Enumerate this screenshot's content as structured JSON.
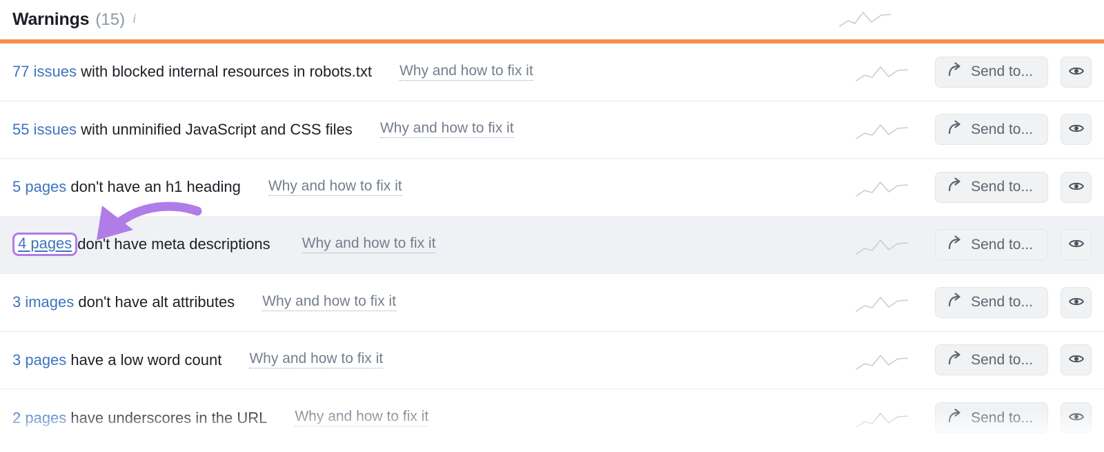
{
  "header": {
    "title": "Warnings",
    "count": "(15)",
    "info_icon": "info-icon",
    "accent_color": "#f8904b"
  },
  "colors": {
    "link_blue": "#3d74bd",
    "annotation_purple": "#b07ce8",
    "highlight_row_bg": "#eff1f5",
    "accent_orange": "#f8904b"
  },
  "actions": {
    "send_to_label": "Send to...",
    "send_to_icon": "share-arrow-icon",
    "preview_icon": "eye-icon",
    "sparkline_icon": "trend-sparkline-icon"
  },
  "fix_link_label": "Why and how to fix it",
  "rows": [
    {
      "count": "77 issues",
      "description": " with blocked internal resources in robots.txt",
      "fix_label": "Why and how to fix it",
      "highlighted": false,
      "faded": false
    },
    {
      "count": "55 issues",
      "description": " with unminified JavaScript and CSS files",
      "fix_label": "Why and how to fix it",
      "highlighted": false,
      "faded": false
    },
    {
      "count": "5 pages",
      "description": " don't have an h1 heading",
      "fix_label": "Why and how to fix it",
      "highlighted": false,
      "faded": false
    },
    {
      "count": "4 pages",
      "description": "don't have meta descriptions",
      "fix_label": "Why and how to fix it",
      "highlighted": true,
      "faded": false
    },
    {
      "count": "3 images",
      "description": " don't have alt attributes",
      "fix_label": "Why and how to fix it",
      "highlighted": false,
      "faded": false
    },
    {
      "count": "3 pages",
      "description": " have a low word count",
      "fix_label": "Why and how to fix it",
      "highlighted": false,
      "faded": false
    },
    {
      "count": "2 pages",
      "description": " have underscores in the URL",
      "fix_label": "Why and how to fix it",
      "highlighted": false,
      "faded": true
    }
  ]
}
